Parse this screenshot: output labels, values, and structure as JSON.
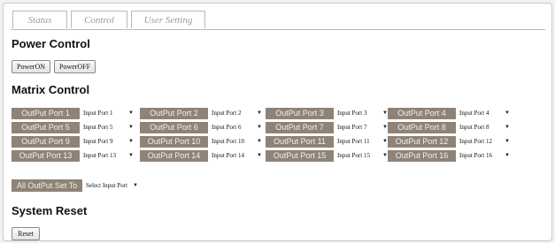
{
  "tabs": [
    "Status",
    "Control",
    "User Setting"
  ],
  "power": {
    "title": "Power Control",
    "on_label": "PowerON",
    "off_label": "PowerOFF"
  },
  "matrix": {
    "title": "Matrix Control",
    "ports": [
      {
        "label": "OutPut Port 1",
        "input": "Input Port 1"
      },
      {
        "label": "OutPut Port 2",
        "input": "Input Port 2"
      },
      {
        "label": "OutPut Port 3",
        "input": "Input Port 3"
      },
      {
        "label": "OutPut Port 4",
        "input": "Input Port 4"
      },
      {
        "label": "OutPut Port 5",
        "input": "Input Port 5"
      },
      {
        "label": "OutPut Port 6",
        "input": "Input Port 6"
      },
      {
        "label": "OutPut Port 7",
        "input": "Input Port 7"
      },
      {
        "label": "OutPut Port 8",
        "input": "Input Port 8"
      },
      {
        "label": "OutPut Port 9",
        "input": "Input Port 9"
      },
      {
        "label": "OutPut Port 10",
        "input": "Input Port 10"
      },
      {
        "label": "OutPut Port 11",
        "input": "Input Port 11"
      },
      {
        "label": "OutPut Port 12",
        "input": "Input Port 12"
      },
      {
        "label": "OutPut Port 13",
        "input": "Input Port 13"
      },
      {
        "label": "OutPut Port 14",
        "input": "Input Port 14"
      },
      {
        "label": "OutPut Port 15",
        "input": "Input Port 15"
      },
      {
        "label": "OutPut Port 16",
        "input": "Input Port 16"
      }
    ],
    "all_label": "All OutPut Set To",
    "all_select": "Select Input Port"
  },
  "reset": {
    "title": "System Reset",
    "button_label": "Reset"
  },
  "icons": {
    "dropdown": "chevron-down-icon"
  },
  "colors": {
    "port_label_bg": "#8f8378",
    "port_label_text": "#f4f0ea"
  }
}
